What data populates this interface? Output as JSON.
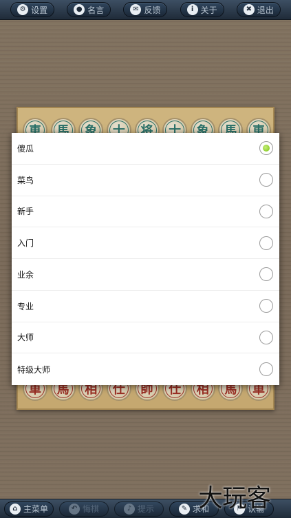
{
  "topbar": {
    "buttons": [
      {
        "label": "设置",
        "icon": "gear-icon",
        "glyph": "⚙"
      },
      {
        "label": "名言",
        "icon": "speech-bubble-icon",
        "glyph": "●"
      },
      {
        "label": "反馈",
        "icon": "envelope-icon",
        "glyph": "✉"
      },
      {
        "label": "关于",
        "icon": "info-icon",
        "glyph": "i"
      },
      {
        "label": "退出",
        "icon": "close-icon",
        "glyph": "✖"
      }
    ]
  },
  "board": {
    "top_row": [
      "車",
      "馬",
      "象",
      "士",
      "将",
      "士",
      "象",
      "馬",
      "車"
    ],
    "bottom_row": [
      "車",
      "馬",
      "相",
      "仕",
      "帥",
      "仕",
      "相",
      "馬",
      "車"
    ],
    "colors": {
      "green": "#2d7a70",
      "red": "#a83226"
    }
  },
  "dialog": {
    "selected_index": 0,
    "options": [
      {
        "label": "傻瓜"
      },
      {
        "label": "菜鸟"
      },
      {
        "label": "新手"
      },
      {
        "label": "入门"
      },
      {
        "label": "业余"
      },
      {
        "label": "专业"
      },
      {
        "label": "大师"
      },
      {
        "label": "特级大师"
      }
    ]
  },
  "bottombar": {
    "buttons": [
      {
        "label": "主菜单",
        "icon": "home-icon",
        "glyph": "⌂",
        "enabled": true
      },
      {
        "label": "悔棋",
        "icon": "undo-icon",
        "glyph": "↶",
        "enabled": false
      },
      {
        "label": "提示",
        "icon": "bell-icon",
        "glyph": "♪",
        "enabled": false
      },
      {
        "label": "求和",
        "icon": "pencil-icon",
        "glyph": "✎",
        "enabled": true
      },
      {
        "label": "认输",
        "icon": "flag-icon",
        "glyph": "⚑",
        "enabled": true
      }
    ]
  },
  "watermark": {
    "text": "大玩客"
  }
}
